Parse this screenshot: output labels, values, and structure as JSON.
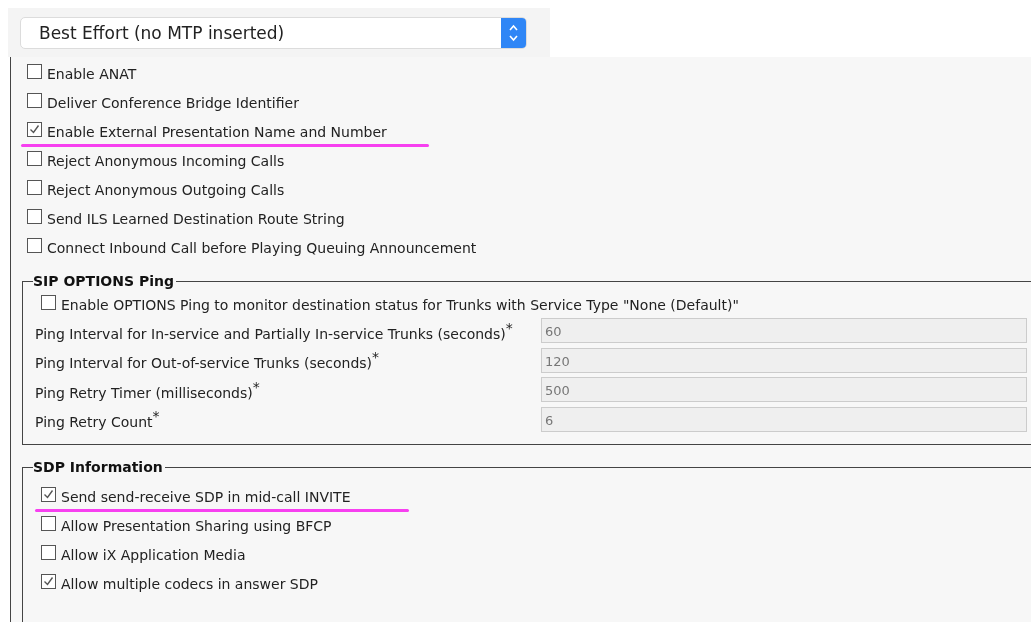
{
  "mtp_select": {
    "value": "Best Effort (no MTP inserted)"
  },
  "options": [
    {
      "label": "Enable ANAT",
      "checked": false,
      "underlined": false
    },
    {
      "label": "Deliver Conference Bridge Identifier",
      "checked": false,
      "underlined": false
    },
    {
      "label": "Enable External Presentation Name and Number",
      "checked": true,
      "underlined": true
    },
    {
      "label": "Reject Anonymous Incoming Calls",
      "checked": false,
      "underlined": false
    },
    {
      "label": "Reject Anonymous Outgoing Calls",
      "checked": false,
      "underlined": false
    },
    {
      "label": "Send ILS Learned Destination Route String",
      "checked": false,
      "underlined": false
    },
    {
      "label": "Connect Inbound Call before Playing Queuing Announcement",
      "checked": false,
      "underlined": false
    }
  ],
  "sip_options_ping": {
    "title": "SIP OPTIONS Ping",
    "enable": {
      "label": "Enable OPTIONS Ping to monitor destination status for Trunks with Service Type \"None (Default)\"",
      "checked": false,
      "underlined": false
    },
    "fields": [
      {
        "label": "Ping Interval for In-service and Partially In-service Trunks (seconds)",
        "required": "*",
        "value": "60",
        "disabled": true
      },
      {
        "label": "Ping Interval for Out-of-service Trunks (seconds)",
        "required": "*",
        "value": "120",
        "disabled": true
      },
      {
        "label": "Ping Retry Timer (milliseconds)",
        "required": "*",
        "value": "500",
        "disabled": true
      },
      {
        "label": "Ping Retry Count",
        "required": "*",
        "value": "6",
        "disabled": true
      }
    ]
  },
  "sdp_information": {
    "title": "SDP Information",
    "options": [
      {
        "label": "Send send-receive SDP in mid-call INVITE",
        "checked": true,
        "underlined": true
      },
      {
        "label": "Allow Presentation Sharing using BFCP",
        "checked": false,
        "underlined": false
      },
      {
        "label": "Allow iX Application Media",
        "checked": false,
        "underlined": false
      },
      {
        "label": "Allow multiple codecs in answer SDP",
        "checked": true,
        "underlined": false
      }
    ]
  }
}
